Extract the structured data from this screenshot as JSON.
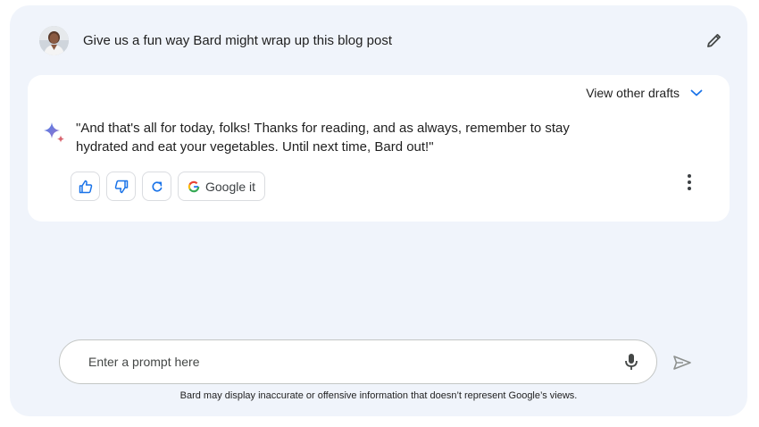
{
  "query": {
    "text": "Give us a fun way Bard might wrap up this blog post"
  },
  "response": {
    "view_drafts_label": "View other drafts",
    "text": "\"And that's all for today, folks! Thanks for reading, and as always, remember to stay hydrated and eat your vegetables. Until next time, Bard out!\"",
    "google_it_label": "Google it"
  },
  "input": {
    "placeholder": "Enter a prompt here",
    "value": ""
  },
  "disclaimer": "Bard may display inaccurate or offensive information that doesn’t represent Google’s views.",
  "icons": {
    "avatar": "user-avatar",
    "edit": "pencil-icon",
    "drafts_toggle": "chevron-down-icon",
    "bard": "sparkle-icon",
    "like": "thumbs-up-icon",
    "dislike": "thumbs-down-icon",
    "regenerate": "refresh-icon",
    "google": "google-g-icon",
    "more": "more-vert-icon",
    "mic": "mic-icon",
    "send": "send-icon"
  },
  "colors": {
    "accent": "#1a73e8",
    "background": "#f0f4fb",
    "card": "#ffffff"
  }
}
